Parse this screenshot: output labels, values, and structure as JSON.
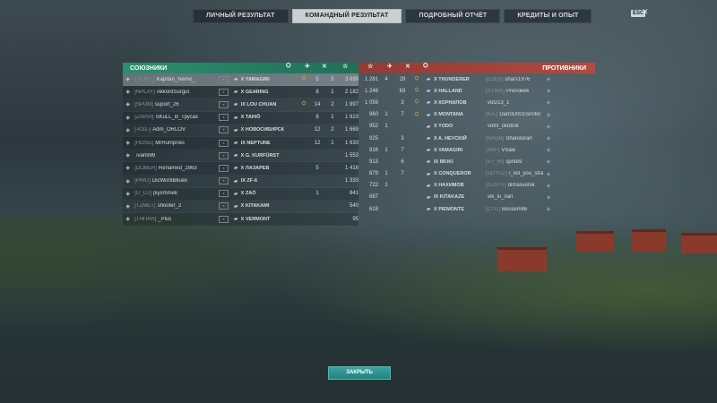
{
  "nav": {
    "tabs": [
      {
        "label": "ЛИЧНЫЙ РЕЗУЛЬТАТ",
        "active": false
      },
      {
        "label": "КОМАНДНЫЙ РЕЗУЛЬТАТ",
        "active": true
      },
      {
        "label": "ПОДРОБНЫЙ ОТЧЁТ",
        "active": false
      },
      {
        "label": "КРЕДИТЫ И ОПЫТ",
        "active": false
      }
    ],
    "esc_label": "ESC",
    "close_glyph": "✕"
  },
  "allies": {
    "title": "СОЮЗНИКИ",
    "rows": [
      {
        "clan": "[_CTD_]",
        "name": "Kapitan_Nemo_",
        "tier": "X",
        "ship": "YAMAGIRI",
        "ribbons": "5",
        "kills": "5",
        "xp": "3 699",
        "medal": true
      },
      {
        "clan": "[NPLAY]",
        "name": "AkkordSurgut",
        "tier": "X",
        "ship": "GEARING",
        "ribbons": "8",
        "kills": "1",
        "xp": "2 182",
        "medal": false
      },
      {
        "clan": "[SPUM]",
        "name": "suport_26",
        "tier": "IX",
        "ship": "LOU CHUAN",
        "ribbons": "14",
        "kills": "2",
        "xp": "1 897",
        "medal": true
      },
      {
        "clan": "[ZAV00]",
        "name": "SKuLL_B_Трусах",
        "tier": "X",
        "ship": "TAIHŌ",
        "ribbons": "8",
        "kills": "1",
        "xp": "1 823",
        "medal": false
      },
      {
        "clan": "[-K31-]",
        "name": "Adm_ORLOV",
        "tier": "X",
        "ship": "НОВОСИБИРСК",
        "ribbons": "12",
        "kills": "2",
        "xp": "1 669",
        "medal": false
      },
      {
        "clan": "[HOSG]",
        "name": "MrHumpries",
        "tier": "IX",
        "ship": "NEPTUNE",
        "ribbons": "12",
        "kills": "1",
        "xp": "1 633",
        "medal": false
      },
      {
        "clan": "",
        "name": "ivan999",
        "tier": "X",
        "ship": "G. KURFÜRST",
        "ribbons": "",
        "kills": "",
        "xp": "1 553",
        "medal": false
      },
      {
        "clan": "[DOBER]",
        "name": "Renamed_2863",
        "tier": "X",
        "ship": "ЛАЗАРЕВ",
        "ribbons": "5",
        "kills": "",
        "xp": "1 418",
        "medal": false
      },
      {
        "clan": "[PIRU]",
        "name": "DicWorldBluex",
        "tier": "IX",
        "ship": "ZF-6",
        "ribbons": "",
        "kills": "",
        "xp": "1 333",
        "medal": false
      },
      {
        "clan": "[U_LU]",
        "name": "piyxmmek",
        "tier": "X",
        "ship": "ZAŌ",
        "ribbons": "1",
        "kills": "",
        "xp": "841",
        "medal": false
      },
      {
        "clan": "[TZMET]",
        "name": "shooter_2",
        "tier": "X",
        "ship": "KITAKAMI",
        "ribbons": "",
        "kills": "",
        "xp": "540",
        "medal": false
      },
      {
        "clan": "[ТНПАН]",
        "name": "_Plus",
        "tier": "X",
        "ship": "VERMONT",
        "ribbons": "",
        "kills": "",
        "xp": "95",
        "medal": false
      }
    ]
  },
  "enemies": {
    "title": "ПРОТИВНИКИ",
    "rows": [
      {
        "dmg": "1 281",
        "ribbons": "4",
        "kills": "29",
        "medal": true,
        "tier": "X",
        "ship": "THUNDERER",
        "clan": "[LOES]",
        "name": "shars1976"
      },
      {
        "dmg": "1 246",
        "ribbons": "",
        "kills": "63",
        "medal": true,
        "tier": "X",
        "ship": "HALLAND",
        "clan": "[STRIX]",
        "name": "Prenokek"
      },
      {
        "dmg": "1 059",
        "ribbons": "",
        "kills": "3",
        "medal": true,
        "tier": "X",
        "ship": "КОРНИЛОВ",
        "clan": "",
        "name": "vol213_1"
      },
      {
        "dmg": "960",
        "ribbons": "1",
        "kills": "7",
        "medal": true,
        "tier": "X",
        "ship": "MONTANA",
        "clan": "[KA-]",
        "name": "Dan0D001Sirotin"
      },
      {
        "dmg": "952",
        "ribbons": "1",
        "kills": "",
        "medal": false,
        "tier": "X",
        "ship": "YODO",
        "clan": "",
        "name": "volni_okotnik"
      },
      {
        "dmg": "925",
        "ribbons": "",
        "kills": "3",
        "medal": false,
        "tier": "X",
        "ship": "A. HEVCKIЙ",
        "clan": "[NAGB]",
        "name": "Shandoran"
      },
      {
        "dmg": "916",
        "ribbons": "1",
        "kills": "7",
        "medal": false,
        "tier": "X",
        "ship": "YAMAGIRI",
        "clan": "[SRF]",
        "name": "VSaw"
      },
      {
        "dmg": "913",
        "ribbons": "",
        "kills": "6",
        "medal": false,
        "tier": "IX",
        "ship": "IBUKI",
        "clan": "[ST_RI]",
        "name": "sprite9"
      },
      {
        "dmg": "879",
        "ribbons": "1",
        "kills": "7",
        "medal": false,
        "tier": "X",
        "ship": "CONQUEROR",
        "clan": "[SOYUZ]",
        "name": "I_kill_you_stra"
      },
      {
        "dmg": "722",
        "ribbons": "1",
        "kills": "",
        "medal": false,
        "tier": "X",
        "ship": "НАХИМОВ",
        "clan": "[GJSTY]",
        "name": "dimasvenik"
      },
      {
        "dmg": "687",
        "ribbons": "",
        "kills": "",
        "medal": false,
        "tier": "IX",
        "ship": "KITAKAZE",
        "clan": "",
        "name": "vik_ki_nan"
      },
      {
        "dmg": "618",
        "ribbons": "",
        "kills": "",
        "medal": false,
        "tier": "X",
        "ship": "PIEMONTE",
        "clan": "[CTG]",
        "name": "Bossem86"
      }
    ]
  },
  "close_button": "ЗАКРЫТЬ"
}
